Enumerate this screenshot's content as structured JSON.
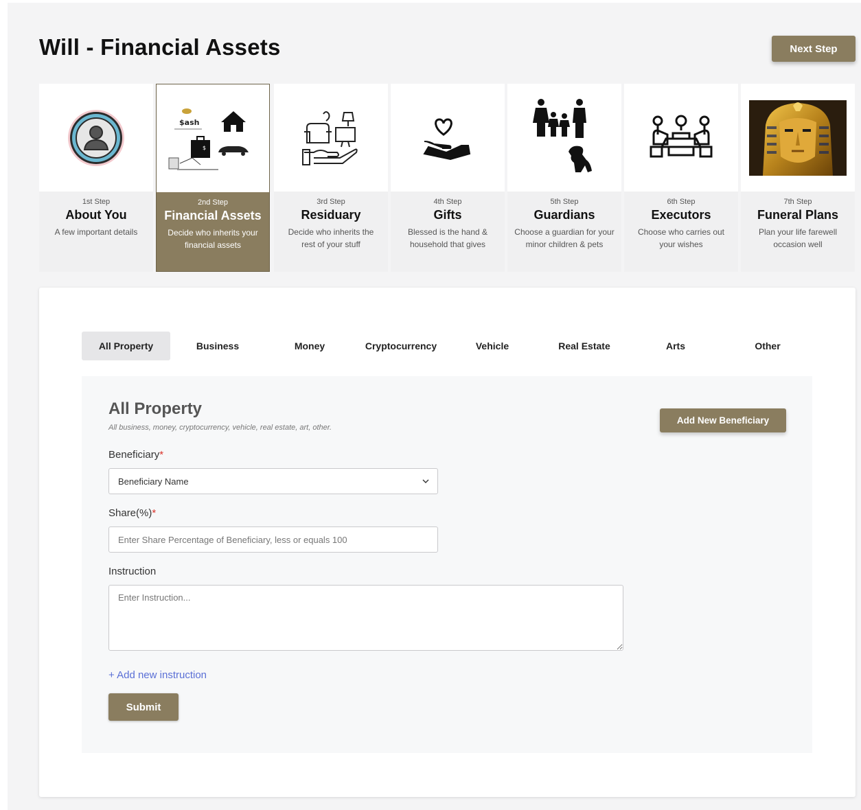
{
  "header": {
    "title": "Will - Financial Assets",
    "next_label": "Next Step"
  },
  "steps": [
    {
      "num": "1st Step",
      "name": "About You",
      "desc": "A few important details",
      "icon": "user-avatar-icon"
    },
    {
      "num": "2nd Step",
      "name": "Financial Assets",
      "desc": "Decide who inherits your financial assets",
      "icon": "financial-assets-icon",
      "img_text": "$ash",
      "active": true
    },
    {
      "num": "3rd Step",
      "name": "Residuary",
      "desc": "Decide who inherits the rest of your stuff",
      "icon": "household-items-icon"
    },
    {
      "num": "4th Step",
      "name": "Gifts",
      "desc": "Blessed is the hand & household that gives",
      "icon": "heart-hand-icon"
    },
    {
      "num": "5th Step",
      "name": "Guardians",
      "desc": "Choose a guardian for your minor children & pets",
      "icon": "family-pet-icon"
    },
    {
      "num": "6th Step",
      "name": "Executors",
      "desc": "Choose who carries out your wishes",
      "icon": "meeting-table-icon"
    },
    {
      "num": "7th Step",
      "name": "Funeral Plans",
      "desc": "Plan your life farewell occasion well",
      "icon": "pharaoh-mask-image"
    }
  ],
  "tabs": [
    {
      "label": "All Property",
      "active": true
    },
    {
      "label": "Business"
    },
    {
      "label": "Money"
    },
    {
      "label": "Cryptocurrency"
    },
    {
      "label": "Vehicle"
    },
    {
      "label": "Real Estate"
    },
    {
      "label": "Arts"
    },
    {
      "label": "Other"
    }
  ],
  "form": {
    "title": "All Property",
    "subtitle": "All business, money, cryptocurrency, vehicle, real estate, art, other.",
    "add_beneficiary_label": "Add New Beneficiary",
    "beneficiary_label": "Beneficiary",
    "required_mark": "*",
    "beneficiary_value": "Beneficiary Name",
    "share_label": "Share(%)",
    "share_placeholder": "Enter Share Percentage of Beneficiary, less or equals 100",
    "instruction_label": "Instruction",
    "instruction_placeholder": "Enter Instruction...",
    "add_instruction_label": "+ Add new instruction",
    "submit_label": "Submit"
  },
  "colors": {
    "accent": "#8a7d5f",
    "link": "#5a6fd6",
    "required": "#d9342b"
  }
}
